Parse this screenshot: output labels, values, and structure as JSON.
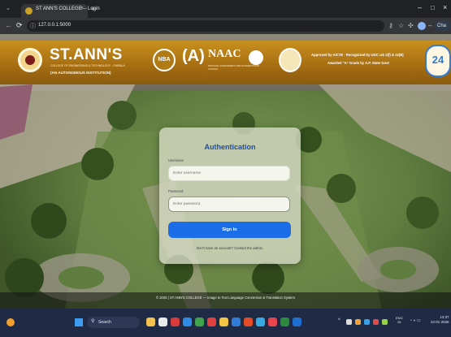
{
  "browser": {
    "tab_title": "ST ANN'S COLLEGE -- Login",
    "tab_close": "×",
    "new_tab": "+",
    "url": "127.0.0.1:5000",
    "chat_label": "Cha"
  },
  "header": {
    "college_name": "ST.ANN'S",
    "college_sub": "COLLEGE OF ENGINEERING & TECHNOLOGY · CHIRALA",
    "college_status": "(AN AUTONOMOUS INSTITUTION)",
    "nba_label": "NBA",
    "naac_grade": "(A)",
    "naac_label": "NAAC",
    "naac_sub": "NATIONAL ASSESSMENT AND ACCREDITATION COUNCIL",
    "approval_text": "Approved by AICTE · Recognized by UGC u/s 2(f) & 12(B)",
    "award_text": "Awarded \"A\" Grade by A.P. State Govt",
    "years_badge": "24"
  },
  "login": {
    "title": "Authentication",
    "username_label": "Username",
    "username_placeholder": "Enter username",
    "password_label": "Password",
    "password_placeholder": "Enter password",
    "signin_label": "Sign In",
    "signup_note": "Don't have an account? Contact the admin."
  },
  "footer": {
    "text": "© 2025 | ST ANN'S COLLEGE — Image to Text Language Conversion & Translation System"
  },
  "taskbar": {
    "search_label": "Search",
    "lang_line1": "ENG",
    "lang_line2": "IN",
    "time": "13:37",
    "date": "22-01-2026"
  },
  "colors": {
    "header_gold": "#b07a14",
    "title_blue": "#1e4fa0",
    "button_blue": "#1c6ee8",
    "taskbar": "#1f2a44"
  }
}
